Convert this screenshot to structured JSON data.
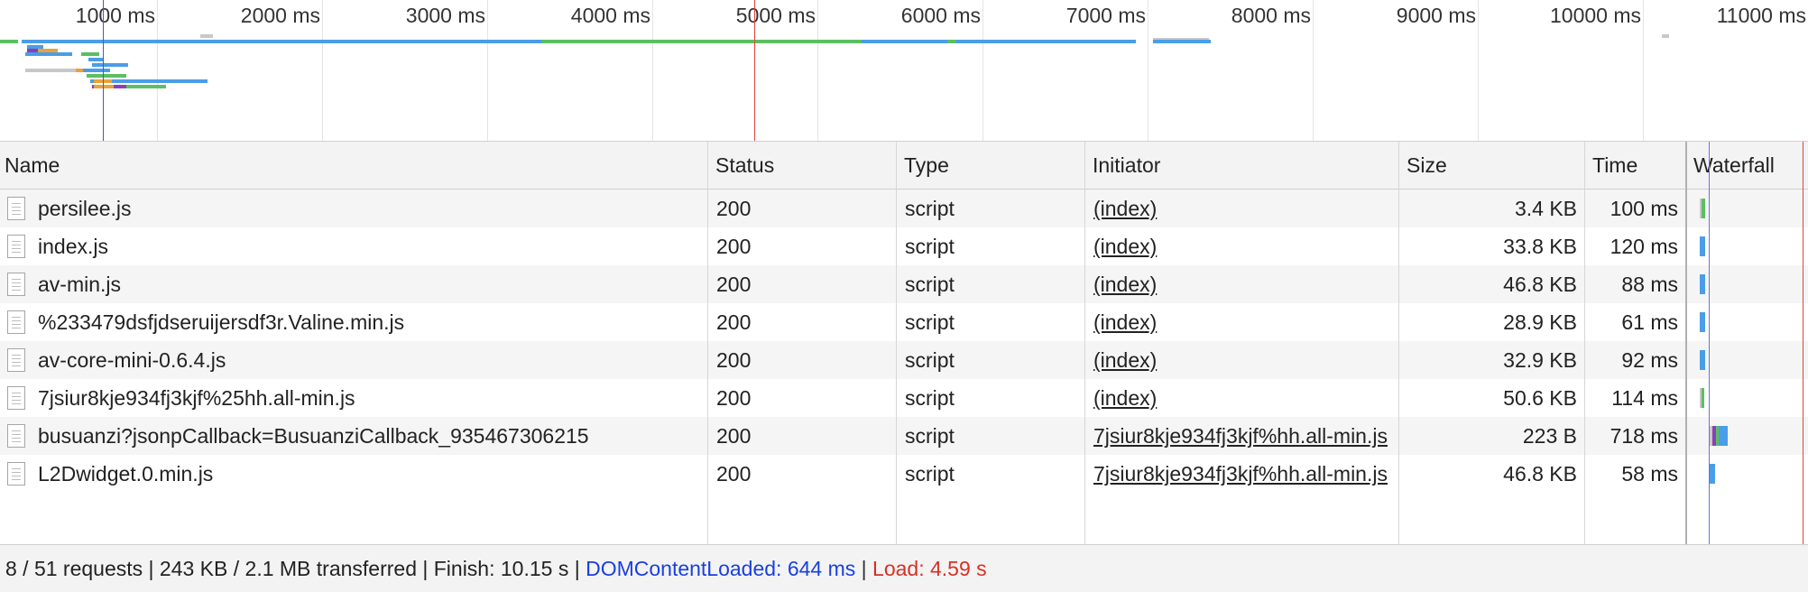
{
  "overview": {
    "ticks": [
      "1000 ms",
      "2000 ms",
      "3000 ms",
      "4000 ms",
      "5000 ms",
      "6000 ms",
      "7000 ms",
      "8000 ms",
      "9000 ms",
      "10000 ms",
      "11000 ms"
    ],
    "dom_content_loaded_color": "#4a53d4",
    "load_color": "#e0453b"
  },
  "columns": {
    "name": "Name",
    "status": "Status",
    "type": "Type",
    "initiator": "Initiator",
    "size": "Size",
    "time": "Time",
    "waterfall": "Waterfall"
  },
  "rows": [
    {
      "name": "persilee.js",
      "status": "200",
      "type": "script",
      "initiator": "(index)",
      "size": "3.4 KB",
      "time": "100 ms"
    },
    {
      "name": "index.js",
      "status": "200",
      "type": "script",
      "initiator": "(index)",
      "size": "33.8 KB",
      "time": "120 ms"
    },
    {
      "name": "av-min.js",
      "status": "200",
      "type": "script",
      "initiator": "(index)",
      "size": "46.8 KB",
      "time": "88 ms"
    },
    {
      "name": "%233479dsfjdseruijersdf3r.Valine.min.js",
      "status": "200",
      "type": "script",
      "initiator": "(index)",
      "size": "28.9 KB",
      "time": "61 ms"
    },
    {
      "name": "av-core-mini-0.6.4.js",
      "status": "200",
      "type": "script",
      "initiator": "(index)",
      "size": "32.9 KB",
      "time": "92 ms"
    },
    {
      "name": "7jsiur8kje934fj3kjf%25hh.all-min.js",
      "status": "200",
      "type": "script",
      "initiator": "(index)",
      "size": "50.6 KB",
      "time": "114 ms"
    },
    {
      "name": "busuanzi?jsonpCallback=BusuanziCallback_935467306215",
      "status": "200",
      "type": "script",
      "initiator": "7jsiur8kje934fj3kjf%hh.all-min.js",
      "size": "223 B",
      "time": "718 ms"
    },
    {
      "name": "L2Dwidget.0.min.js",
      "status": "200",
      "type": "script",
      "initiator": "7jsiur8kje934fj3kjf%hh.all-min.js",
      "size": "46.8 KB",
      "time": "58 ms"
    }
  ],
  "status_bar": {
    "summary": "8 / 51 requests | 243 KB / 2.1 MB transferred | Finish: 10.15 s | ",
    "dom_loaded": "DOMContentLoaded: 644 ms",
    "divider": " | ",
    "load": "Load: 4.59 s",
    "dom_loaded_color": "#1a3fe0",
    "load_color": "#d93025"
  },
  "colors": {
    "bar_blue": "#4a9de8",
    "bar_green": "#5cbf62",
    "bar_purple": "#8c3fb8",
    "bar_orange": "#e8a33a",
    "bar_gray": "#c8c8c8"
  }
}
